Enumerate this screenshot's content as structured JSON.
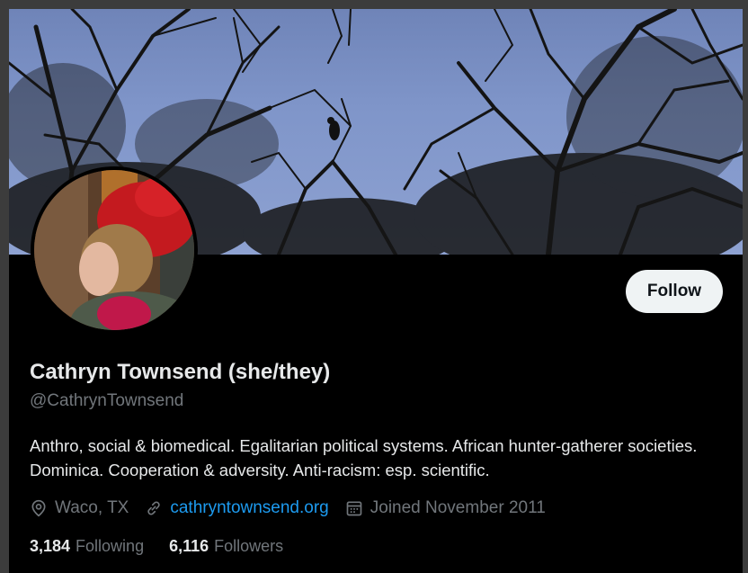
{
  "profile": {
    "display_name": "Cathryn Townsend (she/they)",
    "handle": "@CathrynTownsend",
    "bio": "Anthro, social & biomedical. Egalitarian political systems. African hunter-gatherer societies. Dominica. Cooperation & adversity. Anti-racism: esp. scientific.",
    "location": "Waco, TX",
    "website": "cathryntownsend.org",
    "joined": "Joined November 2011"
  },
  "actions": {
    "follow_label": "Follow"
  },
  "stats": {
    "following_count": "3,184",
    "following_label": "Following",
    "followers_count": "6,116",
    "followers_label": "Followers"
  },
  "icons": {
    "location": "location-pin-icon",
    "website": "link-icon",
    "joined": "calendar-icon"
  },
  "colors": {
    "background": "#000000",
    "text_primary": "#e7e9ea",
    "text_secondary": "#71767b",
    "link": "#1d9bf0",
    "follow_button_bg": "#eff3f4"
  }
}
